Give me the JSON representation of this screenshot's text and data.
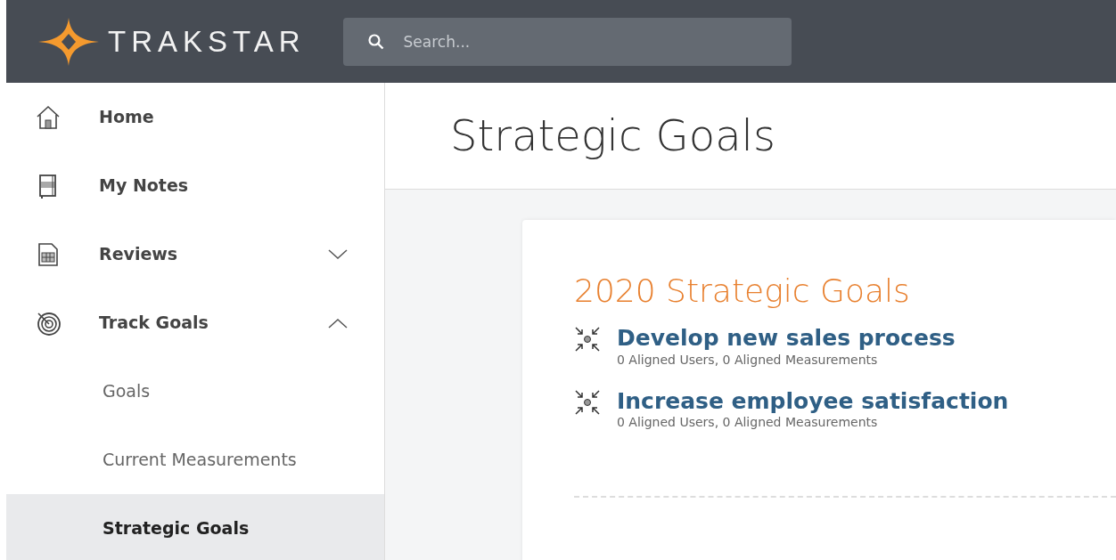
{
  "header": {
    "logo": "TRAKSTAR",
    "search": {
      "placeholder": "Search..."
    }
  },
  "sidebar": {
    "items": [
      {
        "label": "Home",
        "selected": false
      },
      {
        "label": "My Notes",
        "selected": false
      },
      {
        "label": "Reviews",
        "selected": false,
        "expanded": false
      },
      {
        "label": "Track Goals",
        "selected": false,
        "expanded": true,
        "children": [
          {
            "label": "Goals",
            "selected": false
          },
          {
            "label": "Current Measurements",
            "selected": false
          },
          {
            "label": "Strategic Goals",
            "selected": true
          }
        ]
      }
    ]
  },
  "page": {
    "title": "Strategic Goals"
  },
  "goals_card": {
    "title": "2020 Strategic Goals",
    "goals": [
      {
        "title": "Develop new sales process",
        "meta": "0 Aligned Users, 0 Aligned Measurements"
      },
      {
        "title": "Increase employee satisfaction",
        "meta": "0 Aligned Users, 0 Aligned Measurements"
      }
    ]
  }
}
